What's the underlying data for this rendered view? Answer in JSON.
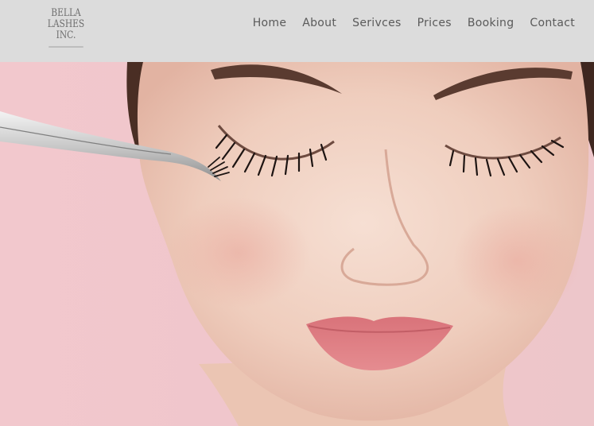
{
  "brand": {
    "logo_lines": [
      "BELLA",
      "LASHES",
      "INC."
    ]
  },
  "nav": {
    "items": [
      {
        "label": "Home"
      },
      {
        "label": "About"
      },
      {
        "label": "Serivces"
      },
      {
        "label": "Prices"
      },
      {
        "label": "Booking"
      },
      {
        "label": "Contact"
      }
    ]
  },
  "colors": {
    "header_bg": "#dcdcdc",
    "hero_bg": "#f0c6cc",
    "nav_text": "#5a5a5a"
  }
}
